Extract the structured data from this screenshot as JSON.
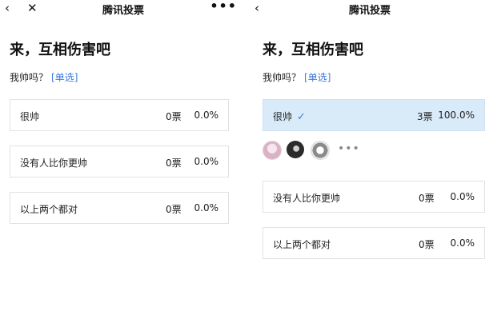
{
  "left": {
    "nav": {
      "title": "腾讯投票",
      "back_glyph": "‹",
      "close_glyph": "✕",
      "more_glyph": "•••"
    },
    "poll_title": "来，互相伤害吧",
    "question": {
      "text": "我帅吗？",
      "type": "[单选]"
    },
    "options": [
      {
        "label": "很帅",
        "votes": "0票",
        "percent": "0.0%"
      },
      {
        "label": "没有人比你更帅",
        "votes": "0票",
        "percent": "0.0%"
      },
      {
        "label": "以上两个都对",
        "votes": "0票",
        "percent": "0.0%"
      }
    ]
  },
  "right": {
    "nav": {
      "title": "腾讯投票",
      "back_glyph": "‹"
    },
    "poll_title": "来，互相伤害吧",
    "question": {
      "text": "我帅吗？",
      "type": "[单选]"
    },
    "options": [
      {
        "label": "很帅",
        "check": "✓",
        "votes": "3票",
        "percent": "100.0%"
      },
      {
        "label": "没有人比你更帅",
        "votes": "0票",
        "percent": "0.0%"
      },
      {
        "label": "以上两个都对",
        "votes": "0票",
        "percent": "0.0%"
      }
    ],
    "voters_more": "•••"
  },
  "colors": {
    "accent": "#3b7ad9",
    "selected_bg": "#d9eaf9",
    "border": "#e2e2e2"
  }
}
